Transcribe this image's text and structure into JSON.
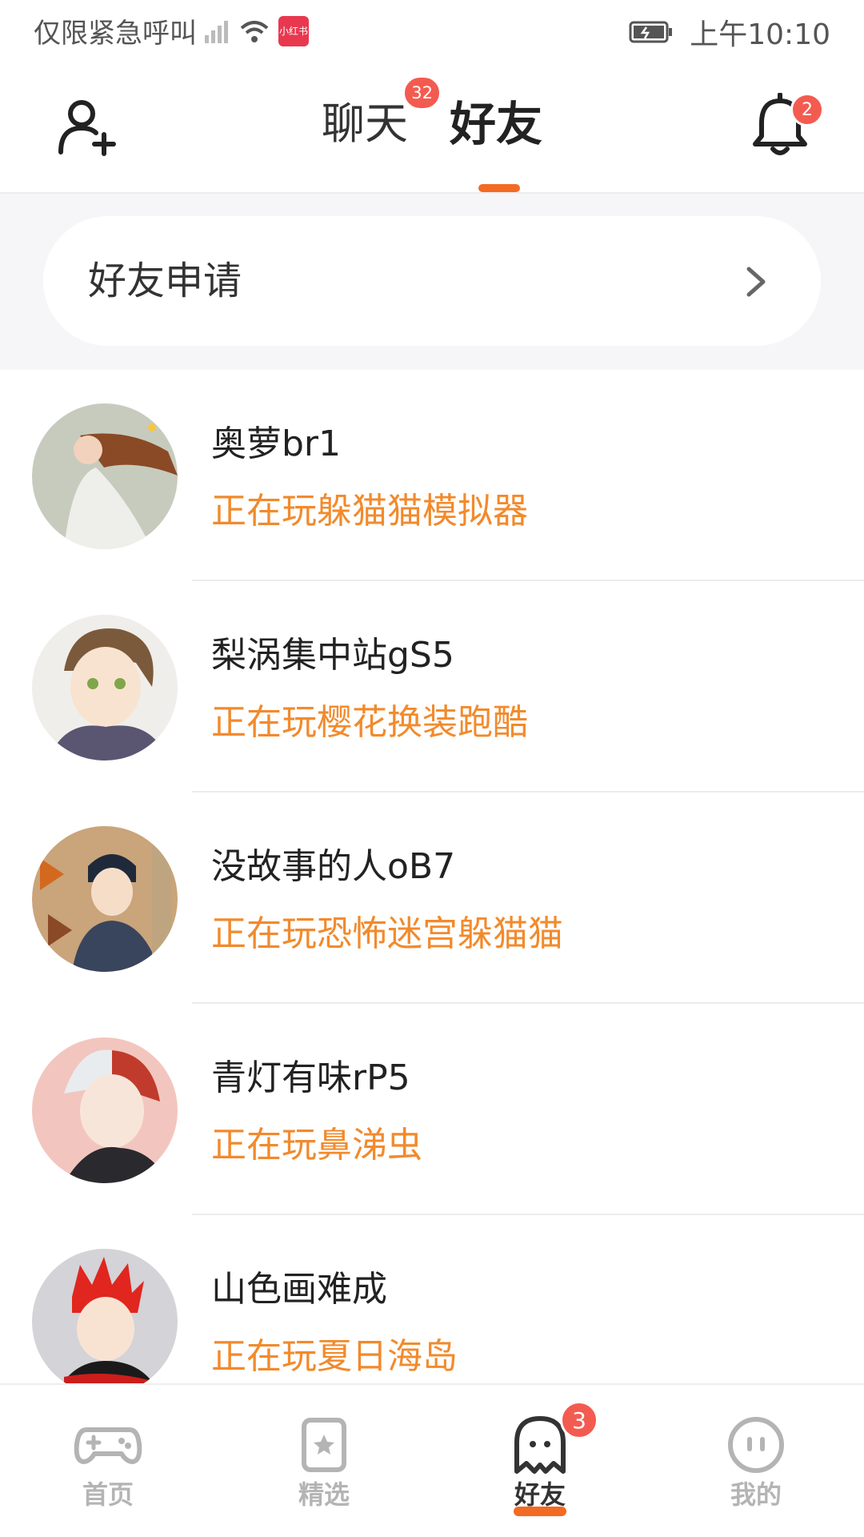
{
  "status_bar": {
    "carrier": "仅限紧急呼叫",
    "app_icon_label": "小红书",
    "time": "上午10:10"
  },
  "header": {
    "tabs": [
      {
        "label": "聊天",
        "badge": "32",
        "active": false
      },
      {
        "label": "好友",
        "active": true
      }
    ],
    "bell_badge": "2"
  },
  "friend_request": {
    "label": "好友申请"
  },
  "friends": [
    {
      "name": "奥萝br1",
      "status": "正在玩躲猫猫模拟器"
    },
    {
      "name": "梨涡集中站gS5",
      "status": "正在玩樱花换装跑酷"
    },
    {
      "name": "没故事的人oB7",
      "status": "正在玩恐怖迷宫躲猫猫"
    },
    {
      "name": "青灯有味rP5",
      "status": "正在玩鼻涕虫"
    },
    {
      "name": "山色画难成",
      "status": "正在玩夏日海岛"
    }
  ],
  "bottom_nav": {
    "items": [
      {
        "label": "首页",
        "icon": "gamepad-icon",
        "active": false
      },
      {
        "label": "精选",
        "icon": "star-card-icon",
        "active": false
      },
      {
        "label": "好友",
        "icon": "ghost-icon",
        "active": true,
        "badge": "3"
      },
      {
        "label": "我的",
        "icon": "face-icon",
        "active": false
      }
    ]
  },
  "colors": {
    "accent": "#f36a23",
    "status_text": "#f28a2c",
    "badge": "#f45b50",
    "section_bg": "#f6f6f8"
  }
}
